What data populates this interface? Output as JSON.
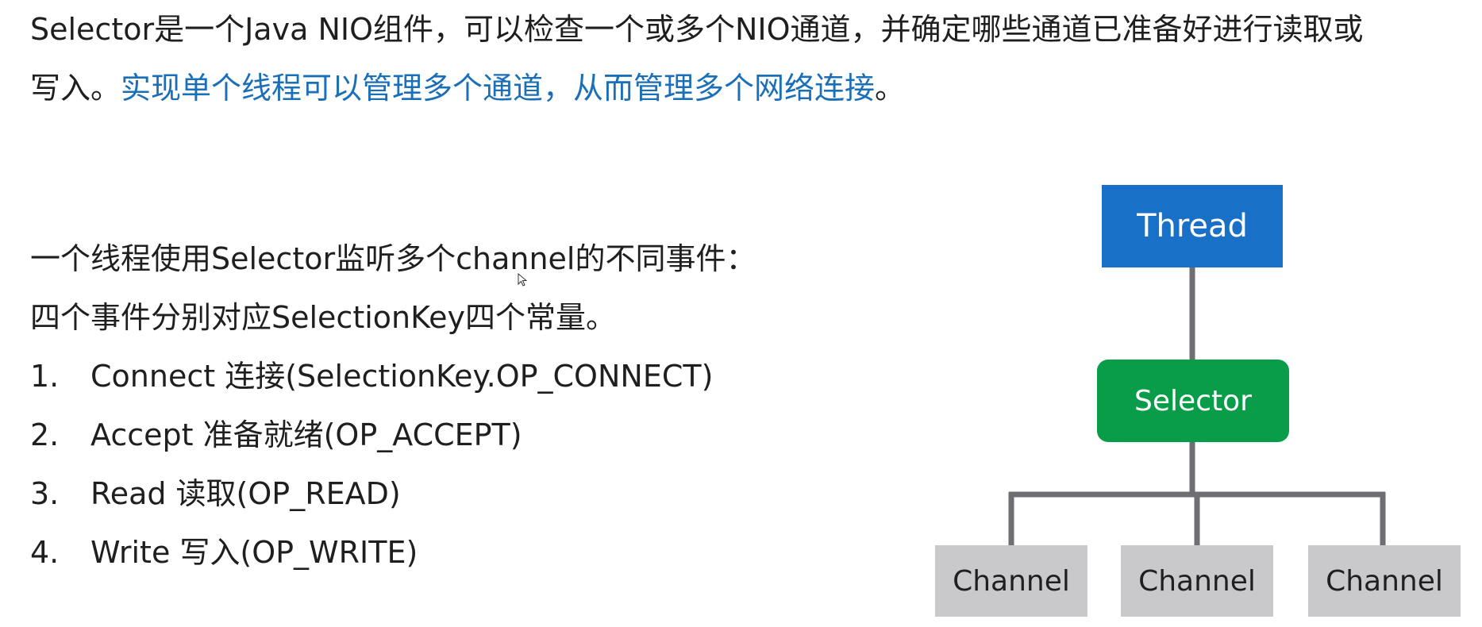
{
  "intro": {
    "line1": "Selector是一个Java NIO组件，可以检查一个或多个NIO通道，并确定哪些通道已准备好进行读取或",
    "line2_prefix": "写入。",
    "line2_highlight": "实现单个线程可以管理多个通道，从而管理多个网络连接",
    "line2_suffix": "。",
    "highlight_color": "#1a6fb8"
  },
  "section": {
    "heading": "一个线程使用Selector监听多个channel的不同事件：",
    "subheading": "四个事件分别对应SelectionKey四个常量。",
    "items": [
      {
        "num": "1.",
        "text": "Connect 连接(SelectionKey.OP_CONNECT)"
      },
      {
        "num": "2.",
        "text": "Accept 准备就绪(OP_ACCEPT)"
      },
      {
        "num": "3.",
        "text": "Read 读取(OP_READ)"
      },
      {
        "num": "4.",
        "text": "Write 写入(OP_WRITE)"
      }
    ]
  },
  "diagram": {
    "thread": {
      "label": "Thread",
      "color": "#1871c6"
    },
    "selector": {
      "label": "Selector",
      "color": "#0a9d49"
    },
    "channels": [
      {
        "label": "Channel"
      },
      {
        "label": "Channel"
      },
      {
        "label": "Channel"
      }
    ],
    "channel_color": "#c9c9cc",
    "connector_color": "#6e6e73"
  }
}
